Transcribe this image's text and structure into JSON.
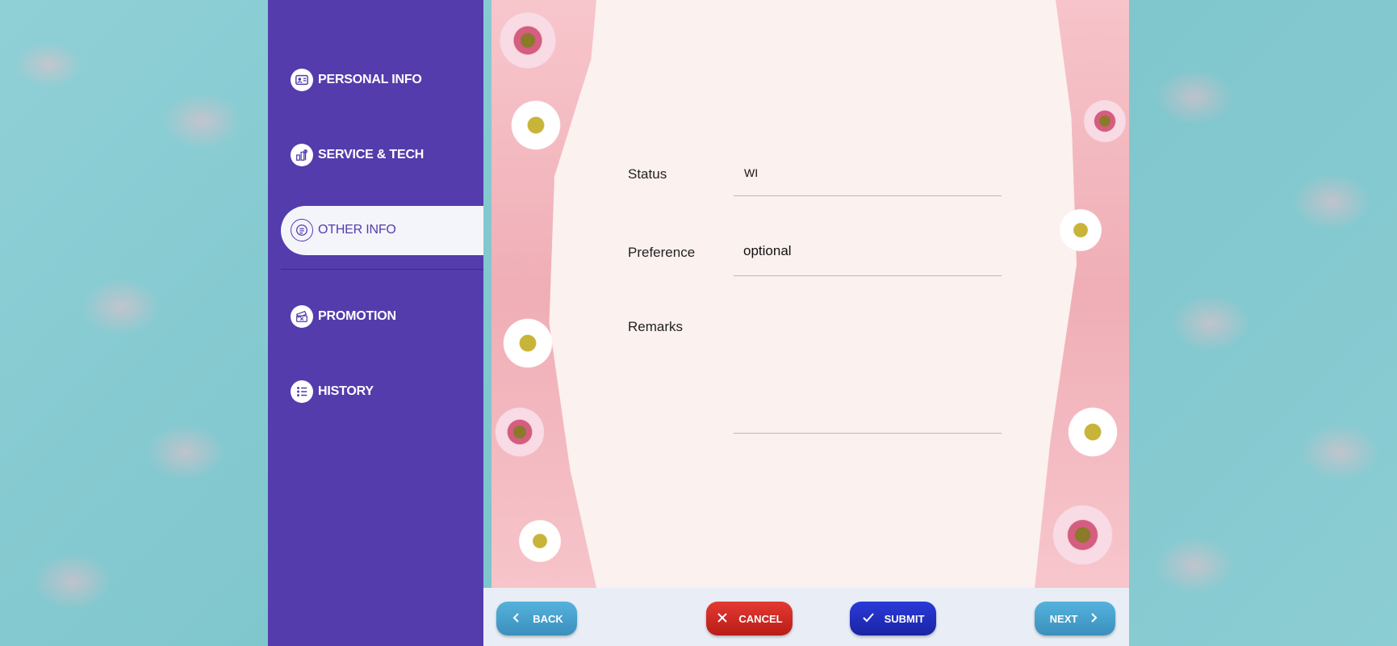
{
  "nav": {
    "items": [
      {
        "label": "PERSONAL INFO",
        "icon": "id-card-icon"
      },
      {
        "label": "SERVICE & TECH",
        "icon": "tools-icon"
      },
      {
        "label": "OTHER INFO",
        "icon": "chat-icon",
        "active": true
      },
      {
        "label": "PROMOTION",
        "icon": "ticket-icon"
      },
      {
        "label": "HISTORY",
        "icon": "list-icon"
      }
    ]
  },
  "form": {
    "status": {
      "label": "Status",
      "value": "WI"
    },
    "preference": {
      "label": "Preference",
      "value": "optional"
    },
    "remarks": {
      "label": "Remarks",
      "value": ""
    }
  },
  "actions": {
    "back": "BACK",
    "cancel": "CANCEL",
    "submit": "SUBMIT",
    "next": "NEXT"
  },
  "colors": {
    "sidebar": "#543cac",
    "form_background": "#fbf1ee",
    "cancel": "#c92a24",
    "submit": "#1f2dbf",
    "back_next": "#4aa3cf"
  }
}
